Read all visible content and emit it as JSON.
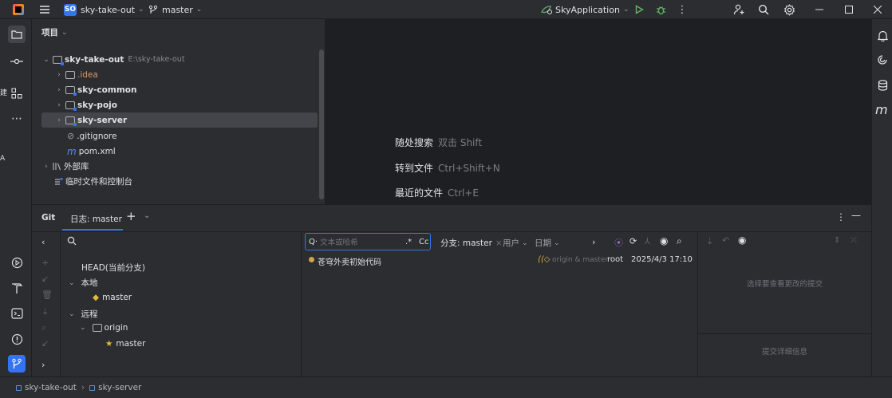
{
  "titlebar": {
    "project_badge": "SO",
    "project_name": "sky-take-out",
    "branch": "master",
    "run_config": "SkyApplication"
  },
  "left_strip_labels": {
    "edge_1": "建",
    "edge_2": "A"
  },
  "project_panel": {
    "title": "项目",
    "tree": [
      {
        "label": "sky-take-out",
        "hint": "E:\\sky-take-out"
      },
      {
        "label": ".idea"
      },
      {
        "label": "sky-common"
      },
      {
        "label": "sky-pojo"
      },
      {
        "label": "sky-server"
      },
      {
        "label": ".gitignore"
      },
      {
        "label": "pom.xml"
      },
      {
        "label": "外部库"
      },
      {
        "label": "临时文件和控制台"
      }
    ]
  },
  "welcome": {
    "items": [
      {
        "label": "随处搜索",
        "shortcut": "双击 Shift"
      },
      {
        "label": "转到文件",
        "shortcut": "Ctrl+Shift+N"
      },
      {
        "label": "最近的文件",
        "shortcut": "Ctrl+E"
      }
    ]
  },
  "git": {
    "tab_git": "Git",
    "tab_log": "日志: master",
    "branches": {
      "head": "HEAD(当前分支)",
      "local": "本地",
      "local_master": "master",
      "remote": "远程",
      "origin": "origin",
      "origin_master": "master"
    },
    "log_toolbar": {
      "search_placeholder": "文本或哈希",
      "regex": ".*",
      "case": "Cc",
      "branch_filter": "分支: master",
      "user_filter": "用户",
      "date_filter": "日期"
    },
    "commits": [
      {
        "message": "苍穹外卖初始代码",
        "refs": "origin & master",
        "author": "root",
        "date": "2025/4/3 17:10"
      }
    ],
    "details": {
      "select_hint": "选择要查看更改的提交",
      "commit_details": "提交详细信息"
    }
  },
  "statusbar": {
    "crumb_1": "sky-take-out",
    "crumb_2": "sky-server"
  },
  "colors": {
    "accent": "#3574f0",
    "background": "#1e1f22",
    "panel": "#2b2d30",
    "selection": "#43454a"
  }
}
